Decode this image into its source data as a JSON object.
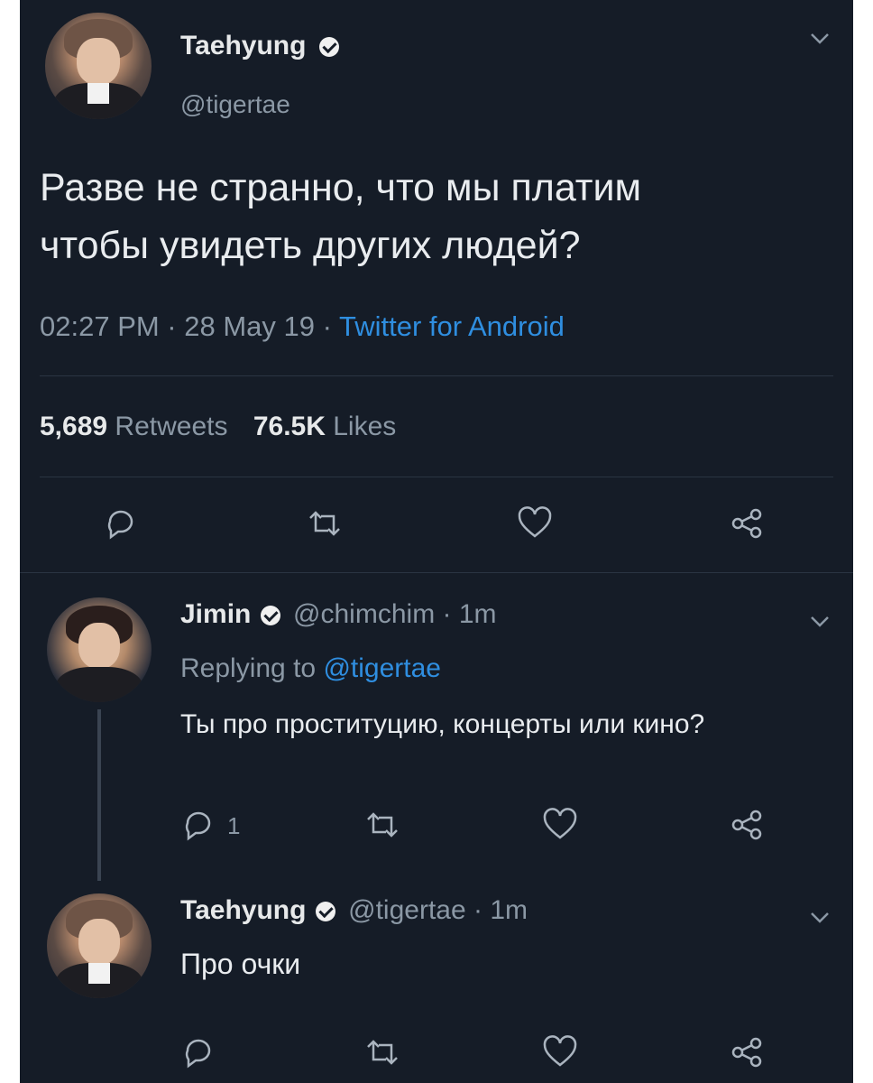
{
  "main_tweet": {
    "display_name": "Taehyung",
    "handle": "@tigertae",
    "text_line1": "Разве не странно, что мы платим",
    "text_line2": "чтобы увидеть других людей?",
    "time": "02:27 PM · 28 May 19 · ",
    "source": "Twitter for Android",
    "retweets_count": "5,689",
    "retweets_label": "Retweets",
    "likes_count": "76.5K",
    "likes_label": "Likes"
  },
  "reply1": {
    "display_name": "Jimin",
    "handle_time": "@chimchim · 1m",
    "replying_prefix": "Replying to ",
    "replying_handle": "@tigertae",
    "text": "Ты про проституцию, концерты или кино?",
    "reply_count": "1"
  },
  "reply2": {
    "display_name": "Taehyung",
    "handle_time": "@tigertae · 1m",
    "text": "Про очки"
  },
  "colors": {
    "background": "#151c27",
    "link": "#2f8ee0",
    "text": "#e9ecef",
    "muted": "#8b98a5"
  },
  "icons": [
    "chevron-down-icon",
    "verified-icon",
    "reply-icon",
    "retweet-icon",
    "like-icon",
    "share-icon"
  ]
}
